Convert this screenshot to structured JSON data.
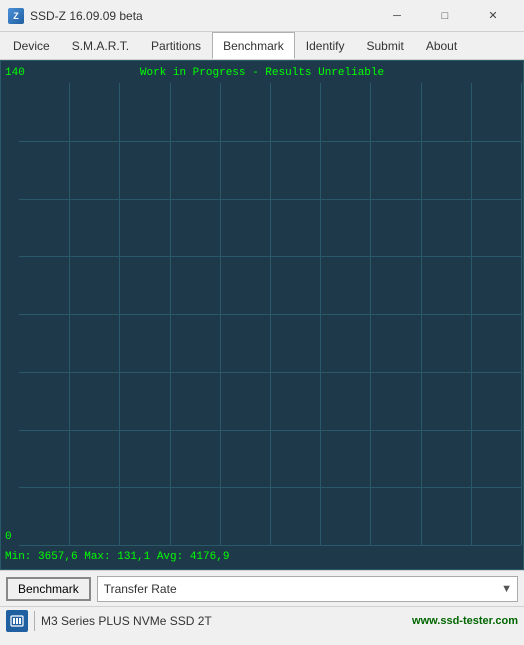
{
  "titleBar": {
    "icon": "Z",
    "title": "SSD-Z 16.09.09 beta",
    "minimizeLabel": "─",
    "maximizeLabel": "□",
    "closeLabel": "✕"
  },
  "menuBar": {
    "items": [
      {
        "label": "Device",
        "active": false
      },
      {
        "label": "S.M.A.R.T.",
        "active": false
      },
      {
        "label": "Partitions",
        "active": false
      },
      {
        "label": "Benchmark",
        "active": true
      },
      {
        "label": "Identify",
        "active": false
      },
      {
        "label": "Submit",
        "active": false
      },
      {
        "label": "About",
        "active": false
      }
    ]
  },
  "chart": {
    "yMaxLabel": "140",
    "yMinLabel": "0",
    "title": "Work in Progress - Results Unreliable",
    "stats": "Min: 3657,6  Max: 131,1  Avg: 4176,9",
    "gridColumns": 10,
    "gridRows": 8
  },
  "toolbar": {
    "benchmarkButton": "Benchmark",
    "dropdownValue": "Transfer Rate",
    "dropdownArrow": "▼"
  },
  "statusBar": {
    "deviceName": "M3 Series PLUS NVMe SSD 2T",
    "website": "www.ssd-tester.com"
  }
}
